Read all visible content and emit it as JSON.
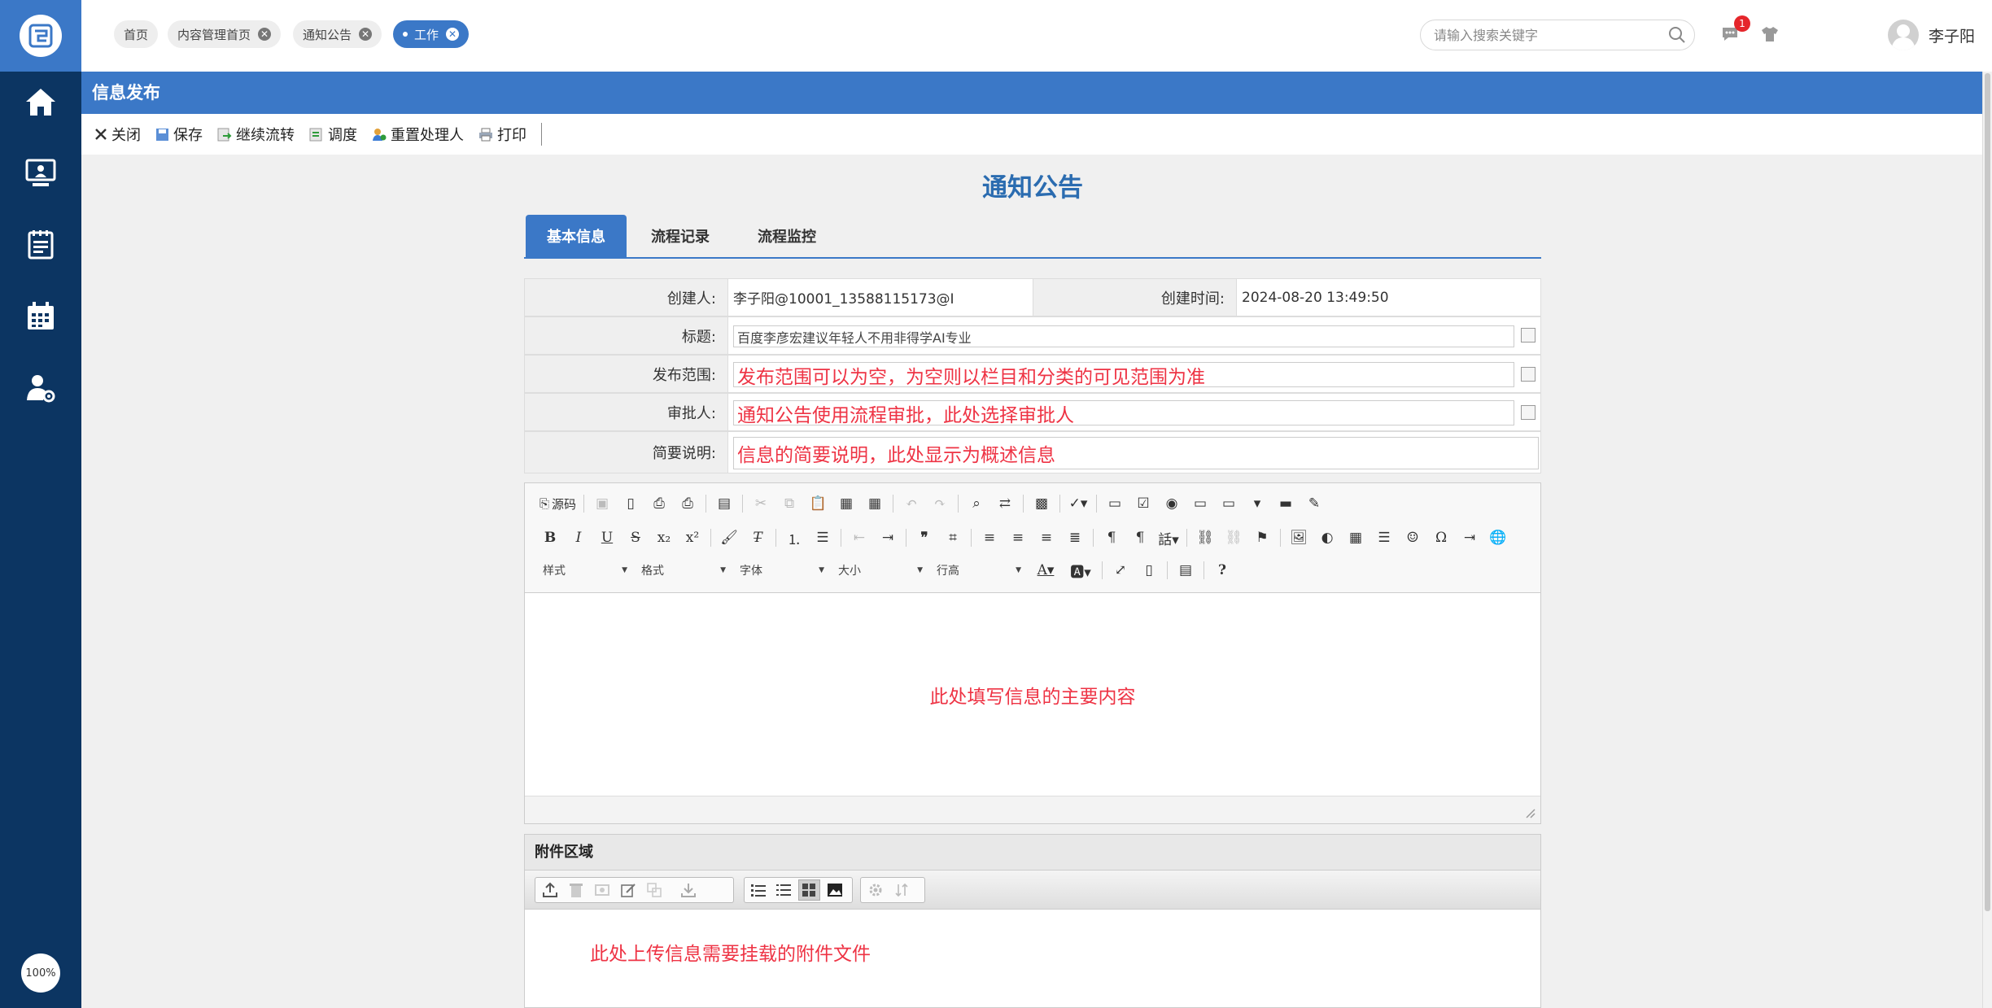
{
  "sidebar": {
    "items": [
      {
        "icon": "home-icon"
      },
      {
        "icon": "monitor-user-icon"
      },
      {
        "icon": "notebook-icon"
      },
      {
        "icon": "calendar-icon"
      },
      {
        "icon": "user-settings-icon"
      }
    ],
    "zoom": "100%"
  },
  "tabs": [
    {
      "label": "首页"
    },
    {
      "label": "内容管理首页"
    },
    {
      "label": "通知公告"
    },
    {
      "label": "工作"
    }
  ],
  "search": {
    "placeholder": "请输入搜索关键字"
  },
  "notifications": {
    "count": "1"
  },
  "user": {
    "name": "李子阳"
  },
  "page": {
    "title": "信息发布"
  },
  "toolbar": {
    "close": "关闭",
    "save": "保存",
    "continue": "继续流转",
    "adjust": "调度",
    "reassign": "重置处理人",
    "print": "打印"
  },
  "form": {
    "title": "通知公告",
    "tabs": [
      "基本信息",
      "流程记录",
      "流程监控"
    ],
    "creator_label": "创建人:",
    "creator_value": "李子阳@10001_13588115173@I",
    "created_time_label": "创建时间:",
    "created_time_value": "2024-08-20 13:49:50",
    "title_label": "标题:",
    "title_value": "百度李彦宏建议年轻人不用非得学AI专业",
    "scope_label": "发布范围:",
    "scope_value": "发布范围可以为空，为空则以栏目和分类的可见范围为准",
    "approver_label": "审批人:",
    "approver_value": "通知公告使用流程审批，此处选择审批人",
    "summary_label": "简要说明:",
    "summary_value": "信息的简要说明，此处显示为概述信息"
  },
  "editor": {
    "source_label": "源码",
    "combos": [
      "样式",
      "格式",
      "字体",
      "大小",
      "行高"
    ],
    "content_hint": "此处填写信息的主要内容"
  },
  "attachments": {
    "title": "附件区域",
    "hint": "此处上传信息需要挂载的附件文件"
  },
  "colors": {
    "sidebar": "#0c3562",
    "accent": "#3b78c7",
    "hint_red": "#ee3344",
    "title_blue": "#2b6cb0"
  }
}
